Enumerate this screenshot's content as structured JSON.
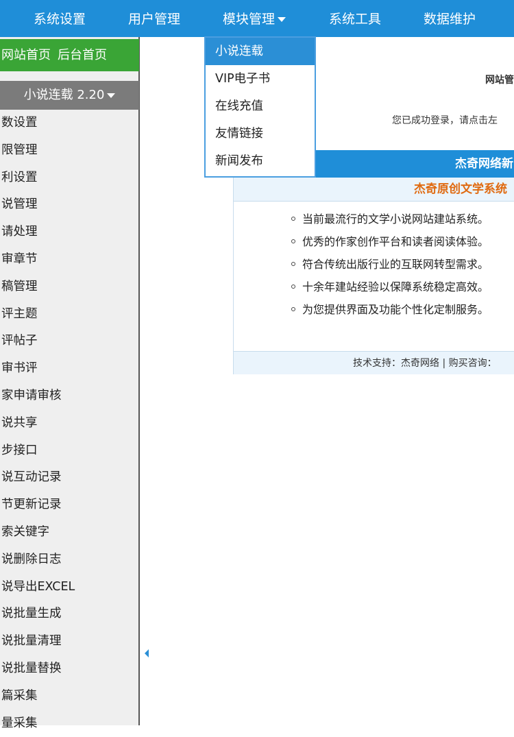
{
  "topnav": {
    "items": [
      "系统设置",
      "用户管理",
      "模块管理",
      "系统工具",
      "数据维护"
    ]
  },
  "sidebar": {
    "top_links": [
      "网站首页",
      "后台首页"
    ],
    "module_header": "小说连载 2.20",
    "items": [
      "数设置",
      "限管理",
      "利设置",
      "说管理",
      "请处理",
      "审章节",
      "稿管理",
      "评主题",
      "评帖子",
      "审书评",
      "家申请审核",
      "说共享",
      "步接口",
      "说互动记录",
      "节更新记录",
      "索关键字",
      "说删除日志",
      "说导出EXCEL",
      "说批量生成",
      "说批量清理",
      "说批量替换",
      "篇采集",
      "量采集"
    ]
  },
  "dropdown": {
    "items": [
      "小说连载",
      "VIP电子书",
      "在线充值",
      "友情链接",
      "新闻发布"
    ],
    "active_index": 0
  },
  "main": {
    "heading": "网站管",
    "welcome": "您已成功登录，请点击左",
    "blue_bar": "杰奇网络新",
    "panel_title": "杰奇原创文学系统",
    "features": [
      "当前最流行的文学小说网站建站系统。",
      "优秀的作家创作平台和读者阅读体验。",
      "符合传统出版行业的互联网转型需求。",
      "十余年建站经验以保障系统稳定高效。",
      "为您提供界面及功能个性化定制服务。"
    ],
    "footer": "技术支持：杰奇网络 | 购买咨询："
  },
  "colors": {
    "nav_blue": "#1f8ed8",
    "green": "#3aa536",
    "module_gray": "#7b7b7b",
    "orange_title": "#e06a10"
  }
}
